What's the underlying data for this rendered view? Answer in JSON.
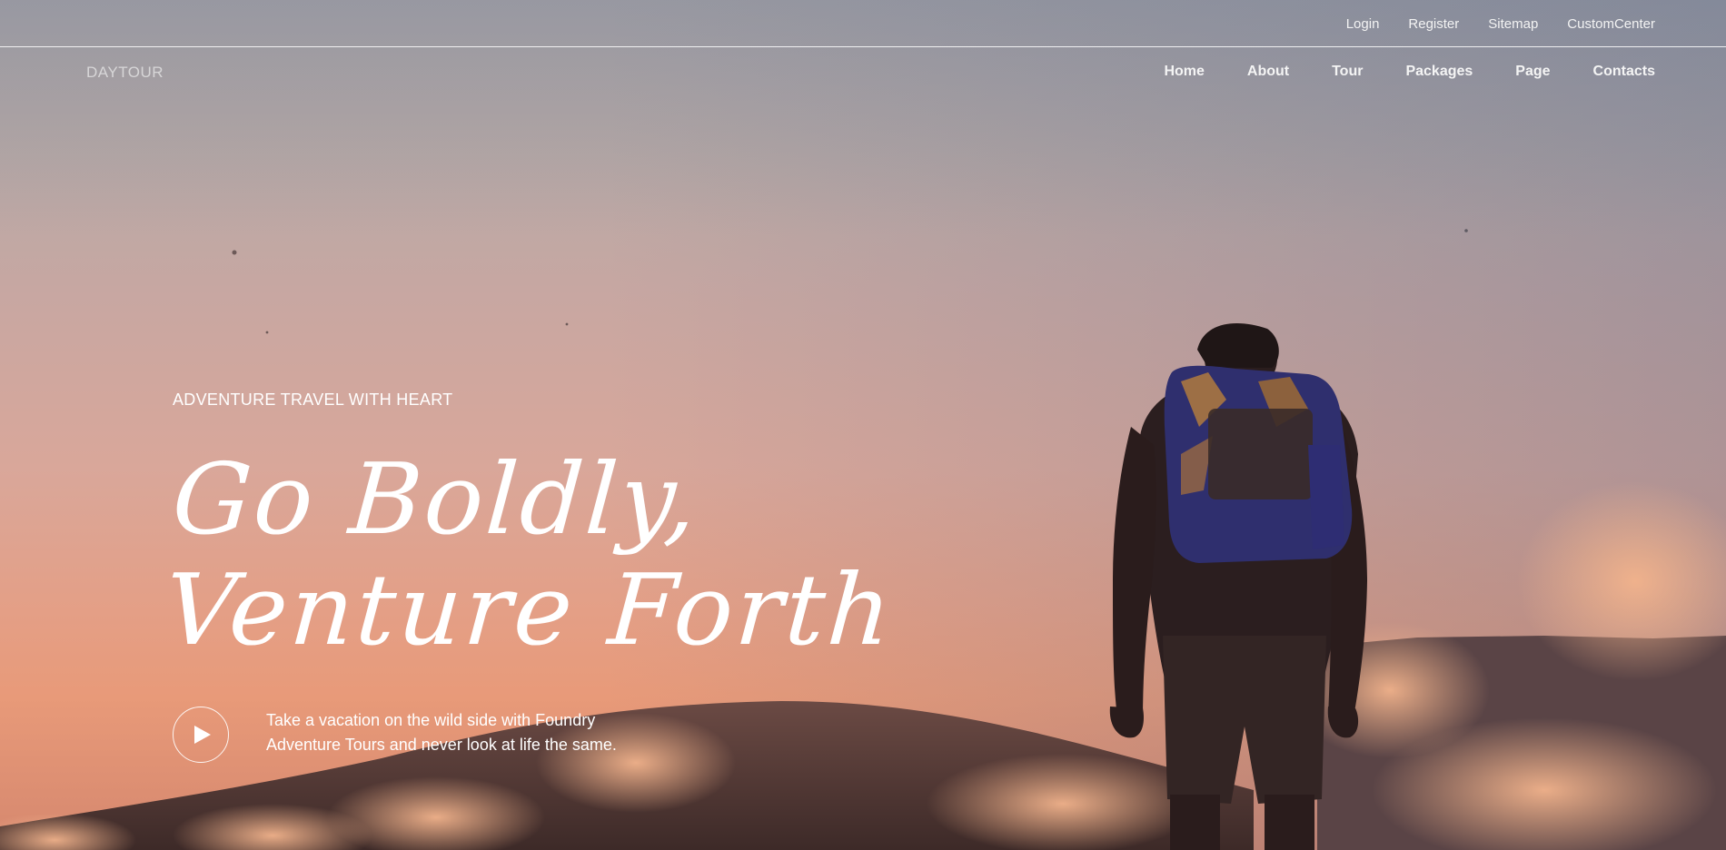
{
  "top_links": [
    "Login",
    "Register",
    "Sitemap",
    "CustomCenter"
  ],
  "brand": "DAYTOUR",
  "nav_items": [
    "Home",
    "About",
    "Tour",
    "Packages",
    "Page",
    "Contacts"
  ],
  "hero": {
    "eyebrow": "ADVENTURE TRAVEL WITH HEART",
    "headline_line1": "Go Boldly,",
    "headline_line2": "Venture Forth",
    "tagline_line1": "Take a vacation on the wild side with Foundry",
    "tagline_line2": "Adventure Tours and never look at life the same.",
    "play_icon": "play-icon"
  }
}
